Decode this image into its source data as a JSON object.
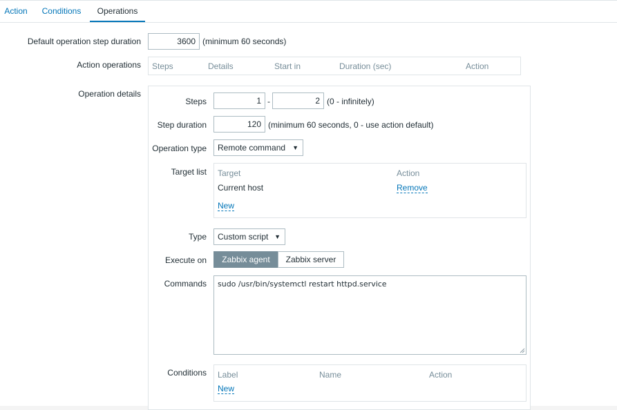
{
  "tabs": [
    {
      "label": "Action",
      "active": false
    },
    {
      "label": "Conditions",
      "active": false
    },
    {
      "label": "Operations",
      "active": true
    }
  ],
  "default_step": {
    "label": "Default operation step duration",
    "value": "3600",
    "hint": "(minimum 60 seconds)"
  },
  "action_operations": {
    "label": "Action operations",
    "columns": [
      "Steps",
      "Details",
      "Start in",
      "Duration (sec)",
      "Action"
    ]
  },
  "operation_details": {
    "label": "Operation details",
    "steps": {
      "label": "Steps",
      "from": "1",
      "separator": "-",
      "to": "2",
      "hint": "(0 - infinitely)"
    },
    "step_duration": {
      "label": "Step duration",
      "value": "120",
      "hint": "(minimum 60 seconds, 0 - use action default)"
    },
    "operation_type": {
      "label": "Operation type",
      "selected": "Remote command"
    },
    "target_list": {
      "label": "Target list",
      "columns": [
        "Target",
        "Action"
      ],
      "rows": [
        {
          "target": "Current host",
          "action": "Remove"
        }
      ],
      "new_label": "New"
    },
    "type": {
      "label": "Type",
      "selected": "Custom script"
    },
    "execute_on": {
      "label": "Execute on",
      "options": [
        "Zabbix agent",
        "Zabbix server"
      ],
      "selected": "Zabbix agent"
    },
    "commands": {
      "label": "Commands",
      "value": "sudo /usr/bin/systemctl restart httpd.service"
    },
    "conditions": {
      "label": "Conditions",
      "columns": [
        "Label",
        "Name",
        "Action"
      ],
      "new_label": "New"
    }
  },
  "colors": {
    "accent": "#0275b8",
    "segment_active": "#768d99",
    "border": "#acbbc2"
  },
  "icons": {
    "dropdown": "caret-down-icon",
    "resize": "resize-grip-icon"
  }
}
